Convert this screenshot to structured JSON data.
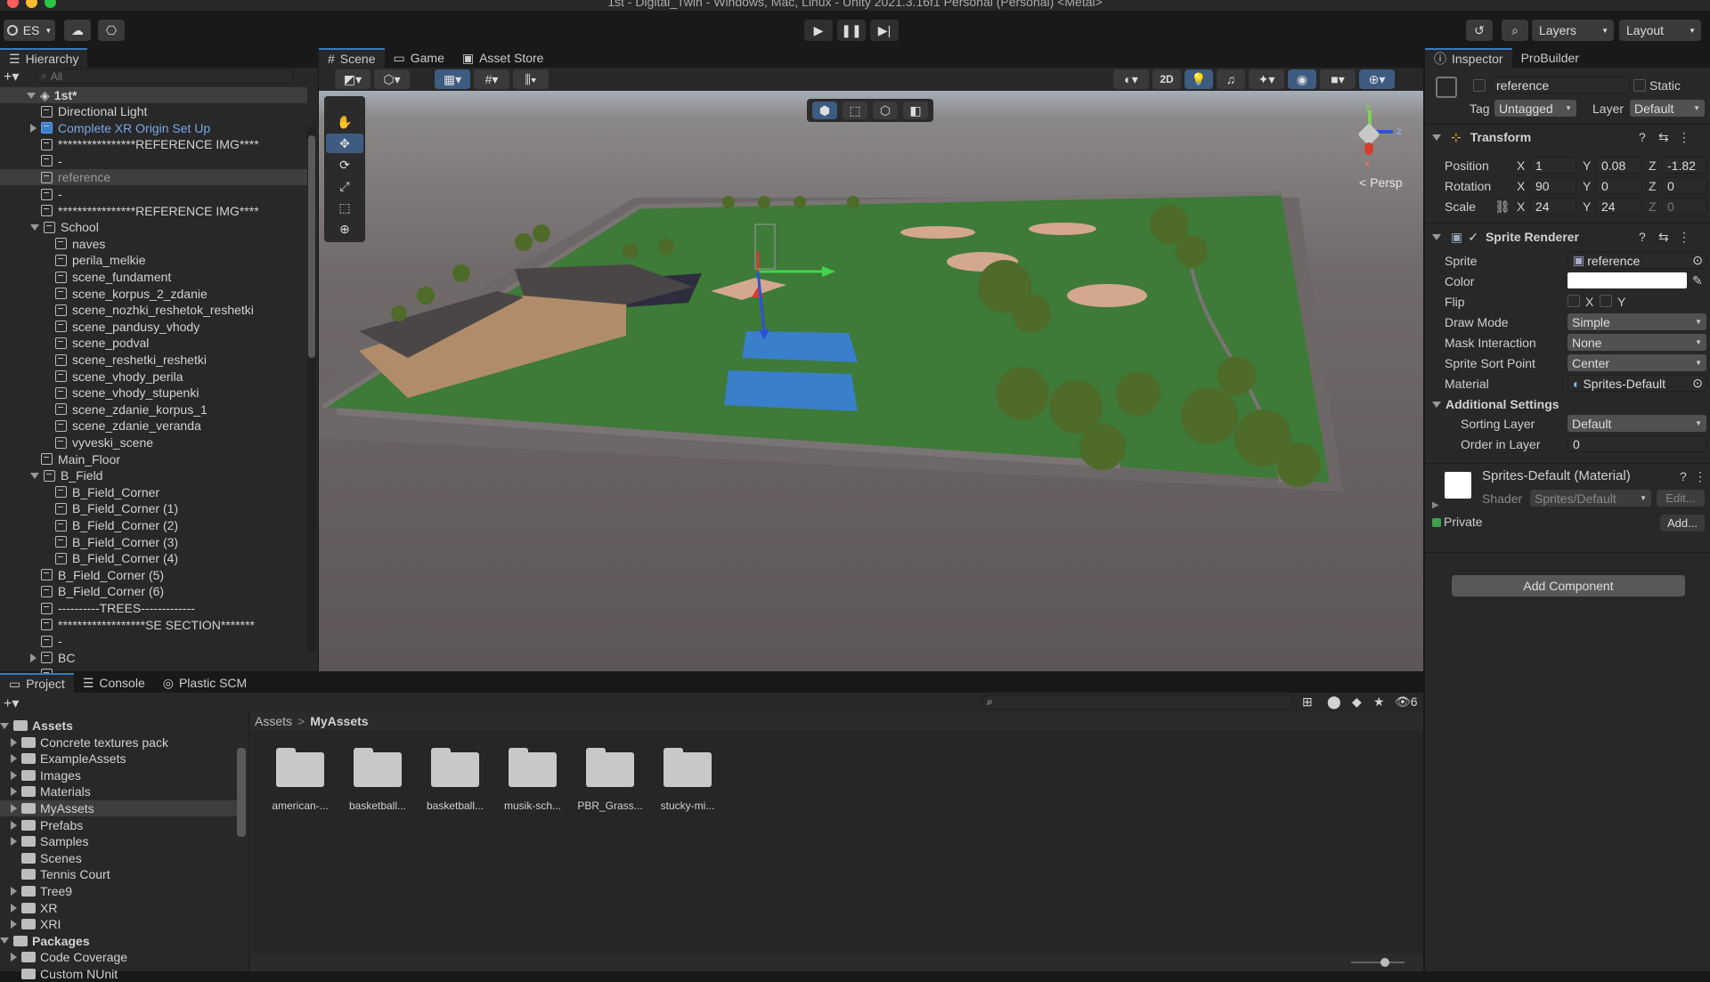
{
  "window": {
    "title": "1st - Digital_Twin - Windows, Mac, Linux - Unity 2021.3.16f1 Personal (Personal) <Metal>"
  },
  "toolbar": {
    "account_label": "ES",
    "layers_label": "Layers",
    "layout_label": "Layout"
  },
  "hierarchy": {
    "tab_label": "Hierarchy",
    "search_placeholder": "All",
    "scene_name": "1st*",
    "items": [
      {
        "label": "Directional Light",
        "depth": 1
      },
      {
        "label": "Complete XR Origin Set Up",
        "depth": 1
      },
      {
        "label": "****************REFERENCE IMG****",
        "depth": 1
      },
      {
        "label": "-",
        "depth": 1
      },
      {
        "label": "reference",
        "depth": 1
      },
      {
        "label": "-",
        "depth": 1
      },
      {
        "label": "****************REFERENCE IMG****",
        "depth": 1
      },
      {
        "label": "School",
        "depth": 1
      },
      {
        "label": "naves",
        "depth": 2
      },
      {
        "label": "perila_melkie",
        "depth": 2
      },
      {
        "label": "scene_fundament",
        "depth": 2
      },
      {
        "label": "scene_korpus_2_zdanie",
        "depth": 2
      },
      {
        "label": "scene_nozhki_reshetok_reshetki",
        "depth": 2
      },
      {
        "label": "scene_pandusy_vhody",
        "depth": 2
      },
      {
        "label": "scene_podval",
        "depth": 2
      },
      {
        "label": "scene_reshetki_reshetki",
        "depth": 2
      },
      {
        "label": "scene_vhody_perila",
        "depth": 2
      },
      {
        "label": "scene_vhody_stupenki",
        "depth": 2
      },
      {
        "label": "scene_zdanie_korpus_1",
        "depth": 2
      },
      {
        "label": "scene_zdanie_veranda",
        "depth": 2
      },
      {
        "label": "vyveski_scene",
        "depth": 2
      },
      {
        "label": "Main_Floor",
        "depth": 1
      },
      {
        "label": "B_Field",
        "depth": 1
      },
      {
        "label": "B_Field_Corner",
        "depth": 2
      },
      {
        "label": "B_Field_Corner (1)",
        "depth": 2
      },
      {
        "label": "B_Field_Corner (2)",
        "depth": 2
      },
      {
        "label": "B_Field_Corner (3)",
        "depth": 2
      },
      {
        "label": "B_Field_Corner (4)",
        "depth": 2
      },
      {
        "label": "B_Field_Corner (5)",
        "depth": 1
      },
      {
        "label": "B_Field_Corner (6)",
        "depth": 1
      },
      {
        "label": "----------TREES-------------",
        "depth": 1
      },
      {
        "label": "******************SE SECTION*******",
        "depth": 1
      },
      {
        "label": "-",
        "depth": 1
      },
      {
        "label": "BC",
        "depth": 1
      },
      {
        "label": "-",
        "depth": 1
      }
    ]
  },
  "scene_tabs": {
    "scene": "Scene",
    "game": "Game",
    "asset_store": "Asset Store"
  },
  "scene_view": {
    "mode_2d": "2D",
    "persp_label": "Persp",
    "gizmo_y": "y",
    "gizmo_z": "z",
    "gizmo_x": "x"
  },
  "inspector": {
    "tab_label": "Inspector",
    "probuilder_label": "ProBuilder",
    "object_name": "reference",
    "static_label": "Static",
    "tag_label": "Tag",
    "tag_value": "Untagged",
    "layer_label": "Layer",
    "layer_value": "Default",
    "transform": {
      "title": "Transform",
      "position_label": "Position",
      "rotation_label": "Rotation",
      "scale_label": "Scale",
      "pos": {
        "x": "1",
        "y": "0.08",
        "z": "-1.82"
      },
      "rot": {
        "x": "90",
        "y": "0",
        "z": "0"
      },
      "scale": {
        "x": "24",
        "y": "24",
        "z": "0"
      }
    },
    "sprite_renderer": {
      "title": "Sprite Renderer",
      "sprite_label": "Sprite",
      "sprite_value": "reference",
      "color_label": "Color",
      "flip_label": "Flip",
      "flip_x": "X",
      "flip_y": "Y",
      "draw_mode_label": "Draw Mode",
      "draw_mode_value": "Simple",
      "mask_label": "Mask Interaction",
      "mask_value": "None",
      "sort_point_label": "Sprite Sort Point",
      "sort_point_value": "Center",
      "material_label": "Material",
      "material_value": "Sprites-Default",
      "additional_label": "Additional Settings",
      "sorting_layer_label": "Sorting Layer",
      "sorting_layer_value": "Default",
      "order_label": "Order in Layer",
      "order_value": "0"
    },
    "material": {
      "title": "Sprites-Default (Material)",
      "shader_label": "Shader",
      "shader_value": "Sprites/Default",
      "edit_label": "Edit...",
      "private_label": "Private",
      "add_label": "Add..."
    },
    "add_component": "Add Component",
    "axis_x": "X",
    "axis_y": "Y",
    "axis_z": "Z"
  },
  "bottom_tabs": {
    "project": "Project",
    "console": "Console",
    "plastic": "Plastic SCM",
    "hidden_count": "6"
  },
  "project": {
    "tree": [
      {
        "label": "Assets",
        "depth": 0,
        "bold": true
      },
      {
        "label": "Concrete textures pack",
        "depth": 1
      },
      {
        "label": "ExampleAssets",
        "depth": 1
      },
      {
        "label": "Images",
        "depth": 1
      },
      {
        "label": "Materials",
        "depth": 1
      },
      {
        "label": "MyAssets",
        "depth": 1
      },
      {
        "label": "Prefabs",
        "depth": 1
      },
      {
        "label": "Samples",
        "depth": 1
      },
      {
        "label": "Scenes",
        "depth": 1
      },
      {
        "label": "Tennis Court",
        "depth": 1
      },
      {
        "label": "Tree9",
        "depth": 1
      },
      {
        "label": "XR",
        "depth": 1
      },
      {
        "label": "XRI",
        "depth": 1
      },
      {
        "label": "Packages",
        "depth": 0,
        "bold": true
      },
      {
        "label": "Code Coverage",
        "depth": 1
      },
      {
        "label": "Custom NUnit",
        "depth": 1
      }
    ],
    "breadcrumb": {
      "root": "Assets",
      "current": "MyAssets"
    },
    "folders": [
      "american-...",
      "basketball...",
      "basketball...",
      "musik-sch...",
      "PBR_Grass...",
      "stucky-mi..."
    ]
  },
  "colors": {
    "accent": "#3a79bb",
    "grass": "#3f7a3c",
    "ground": "#6a6363",
    "sky": "#9aa3ab"
  }
}
